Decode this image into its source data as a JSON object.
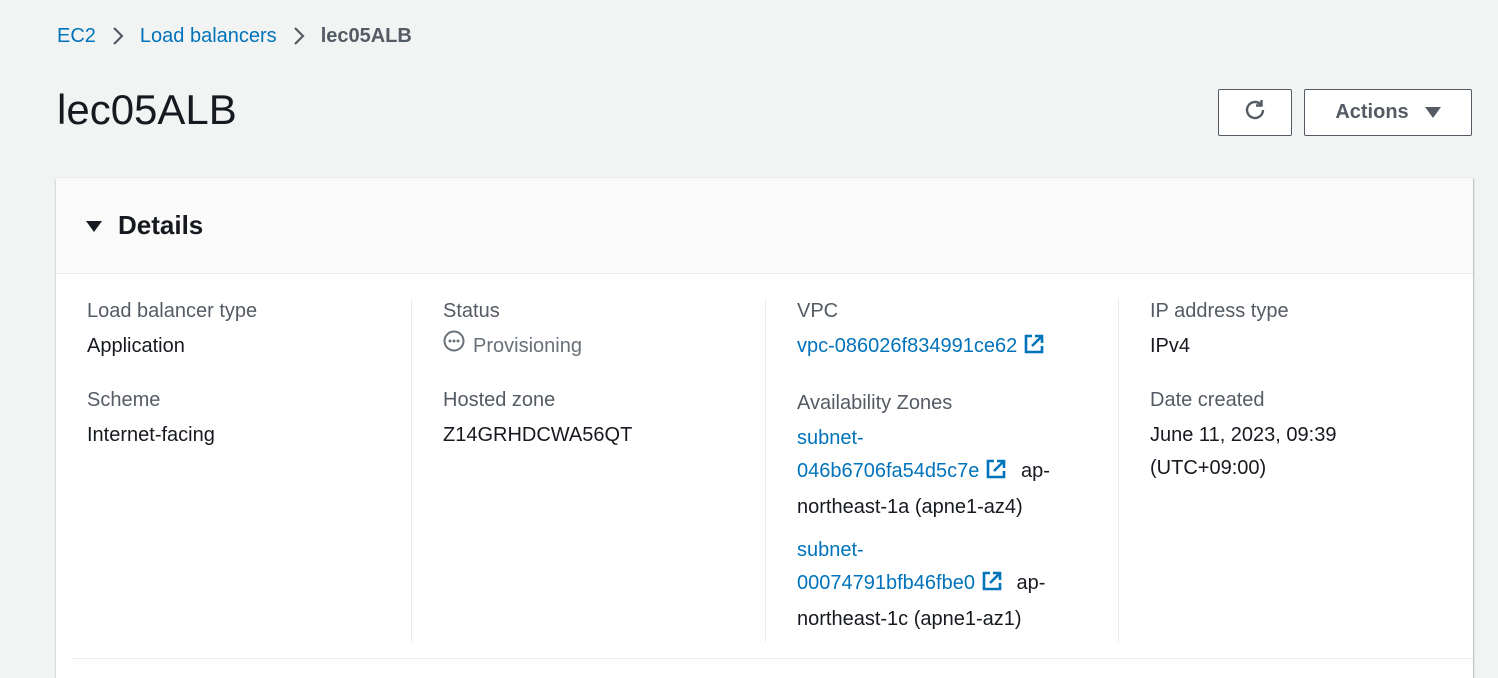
{
  "breadcrumb": {
    "items": [
      "EC2",
      "Load balancers"
    ],
    "current": "lec05ALB"
  },
  "page": {
    "title": "lec05ALB"
  },
  "toolbar": {
    "actions_label": "Actions",
    "refresh_icon": "refresh-icon"
  },
  "details": {
    "header": "Details",
    "load_balancer_type": {
      "label": "Load balancer type",
      "value": "Application"
    },
    "scheme": {
      "label": "Scheme",
      "value": "Internet-facing"
    },
    "status": {
      "label": "Status",
      "value": "Provisioning"
    },
    "hosted_zone": {
      "label": "Hosted zone",
      "value": "Z14GRHDCWA56QT"
    },
    "vpc": {
      "label": "VPC",
      "value": "vpc-086026f834991ce62"
    },
    "availability_zones": {
      "label": "Availability Zones",
      "subnets": [
        {
          "id_line1": "subnet-",
          "id_line2": "046b6706fa54d5c7e",
          "az_suffix": "ap-",
          "az_line2": "northeast-1a (apne1-az4)"
        },
        {
          "id_line1": "subnet-",
          "id_line2": "00074791bfb46fbe0",
          "az_suffix": "ap-",
          "az_line2": "northeast-1c (apne1-az1)"
        }
      ]
    },
    "ip_address_type": {
      "label": "IP address type",
      "value": "IPv4"
    },
    "date_created": {
      "label": "Date created",
      "value_line1": "June 11, 2023, 09:39",
      "value_line2": "(UTC+09:00)"
    }
  },
  "colors": {
    "link": "#0073bb",
    "text": "#16191f",
    "muted": "#545b64",
    "background": "#f2f3f3"
  }
}
